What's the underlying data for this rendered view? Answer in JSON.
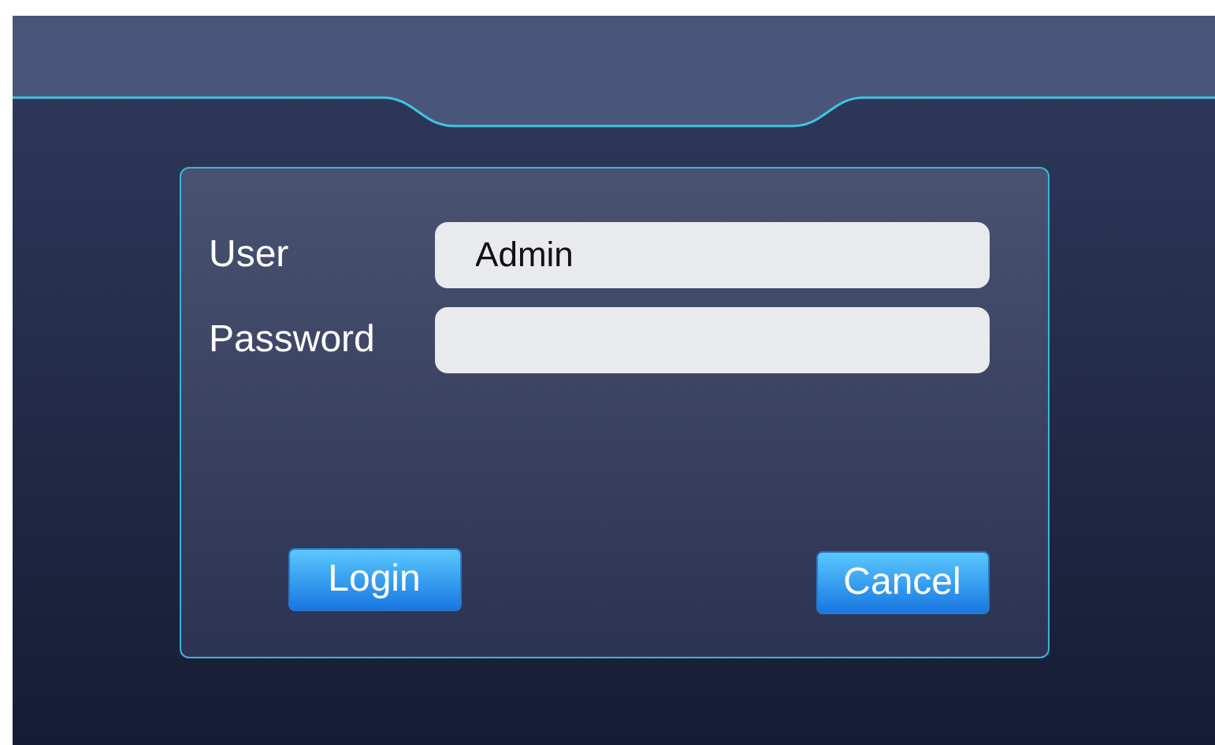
{
  "login_dialog": {
    "fields": [
      {
        "label": "User",
        "value": "Admin"
      },
      {
        "label": "Password"
      }
    ],
    "buttons": [
      {
        "label": "Login"
      },
      {
        "label": "Cancel"
      }
    ]
  }
}
